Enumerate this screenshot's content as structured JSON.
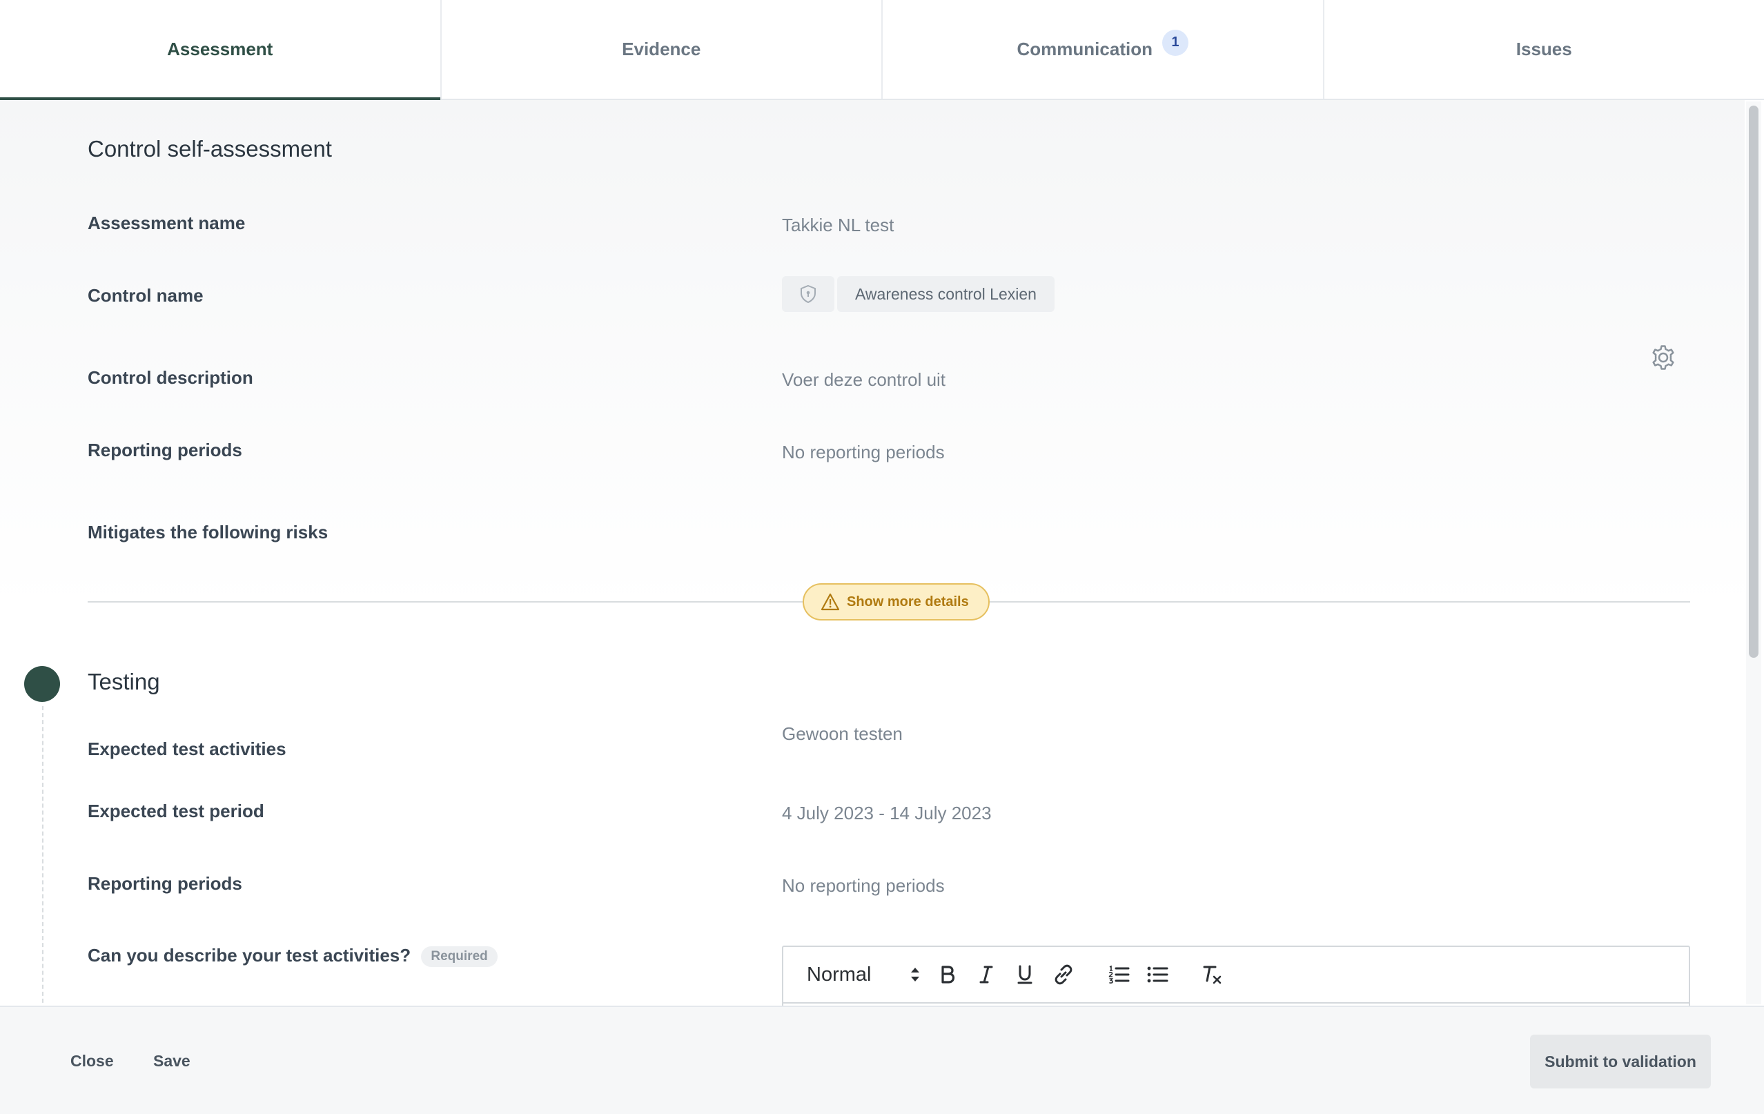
{
  "tabs": [
    {
      "label": "Assessment"
    },
    {
      "label": "Evidence"
    },
    {
      "label": "Communication",
      "badge": "1"
    },
    {
      "label": "Issues"
    }
  ],
  "assessment": {
    "title": "Control self-assessment",
    "assessment_name_label": "Assessment name",
    "assessment_name_value": "Takkie NL test",
    "control_name_label": "Control name",
    "control_name_value": "Awareness control Lexien",
    "control_description_label": "Control description",
    "control_description_value": "Voer deze control uit",
    "reporting_periods_label": "Reporting periods",
    "reporting_periods_value": "No reporting periods",
    "mitigates_label": "Mitigates the following risks",
    "show_more_label": "Show more details"
  },
  "testing": {
    "title": "Testing",
    "expected_activities_label": "Expected test activities",
    "expected_activities_value": "Gewoon testen",
    "expected_period_label": "Expected test period",
    "expected_period_value": "4 July 2023 - 14 July 2023",
    "reporting_periods_label": "Reporting periods",
    "reporting_periods_value": "No reporting periods",
    "describe_label": "Can you describe your test activities?",
    "required_label": "Required"
  },
  "editor": {
    "format_value": "Normal"
  },
  "footer": {
    "close_label": "Close",
    "save_label": "Save",
    "submit_label": "Submit to validation"
  },
  "colors": {
    "accent": "#2f4f46",
    "warning_bg": "#fdefc6",
    "warning_border": "#e6c060",
    "badge_bg": "#dde8fb"
  }
}
